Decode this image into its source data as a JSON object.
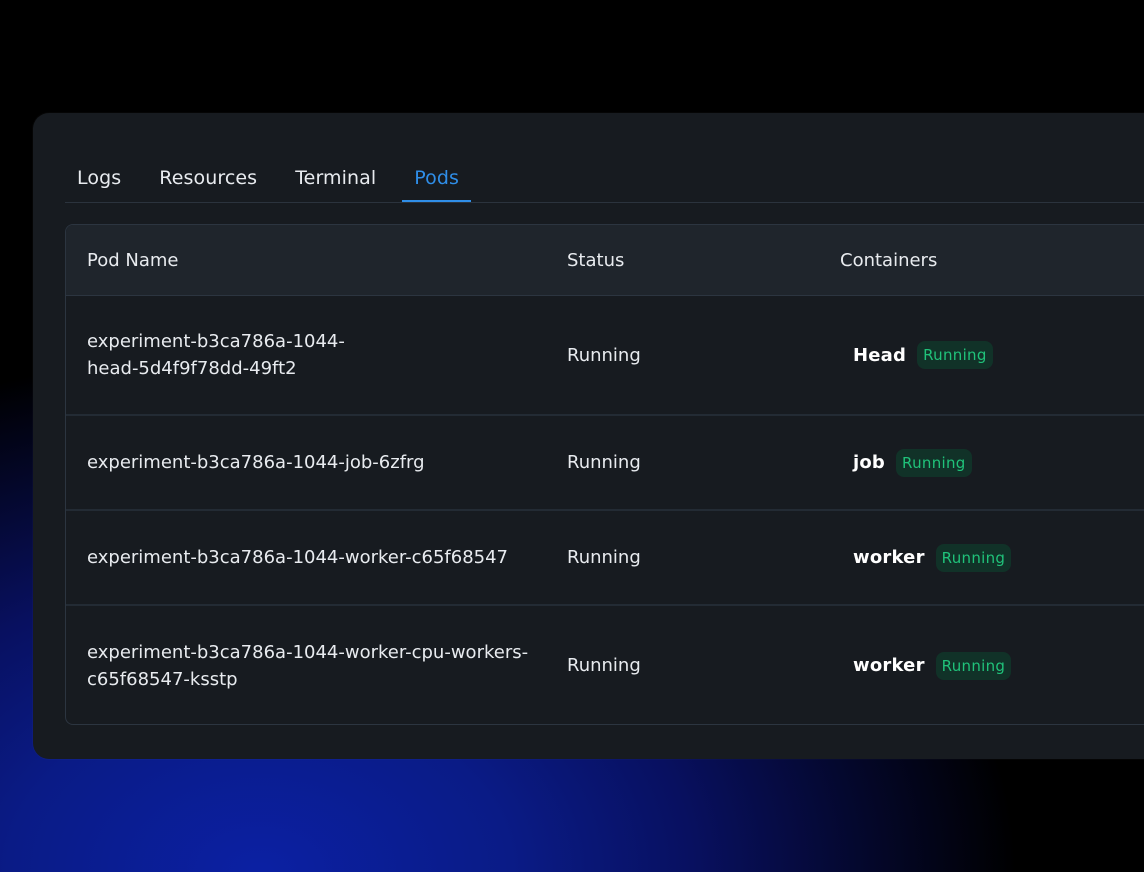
{
  "tabs": [
    {
      "label": "Logs"
    },
    {
      "label": "Resources"
    },
    {
      "label": "Terminal"
    },
    {
      "label": "Pods"
    }
  ],
  "active_tab": "Pods",
  "table": {
    "headers": {
      "pod_name": "Pod Name",
      "status": "Status",
      "containers": "Containers"
    },
    "rows": [
      {
        "pod_name": "experiment-b3ca786a-1044-\nhead-5d4f9f78dd-49ft2",
        "status": "Running",
        "container": "Head",
        "container_status": "Running"
      },
      {
        "pod_name": "experiment-b3ca786a-1044-job-6zfrg",
        "status": "Running",
        "container": "job",
        "container_status": "Running"
      },
      {
        "pod_name": "experiment-b3ca786a-1044-worker-c65f68547",
        "status": "Running",
        "container": "worker",
        "container_status": "Running"
      },
      {
        "pod_name": "experiment-b3ca786a-1044-worker-cpu-workers-\nc65f68547-ksstp",
        "status": "Running",
        "container": "worker",
        "container_status": "Running"
      }
    ]
  },
  "colors": {
    "accent": "#2f8ee8",
    "badge_text": "#20c27a",
    "badge_bg": "#113228",
    "panel_bg": "#171b20",
    "header_bg": "#1f252c"
  }
}
